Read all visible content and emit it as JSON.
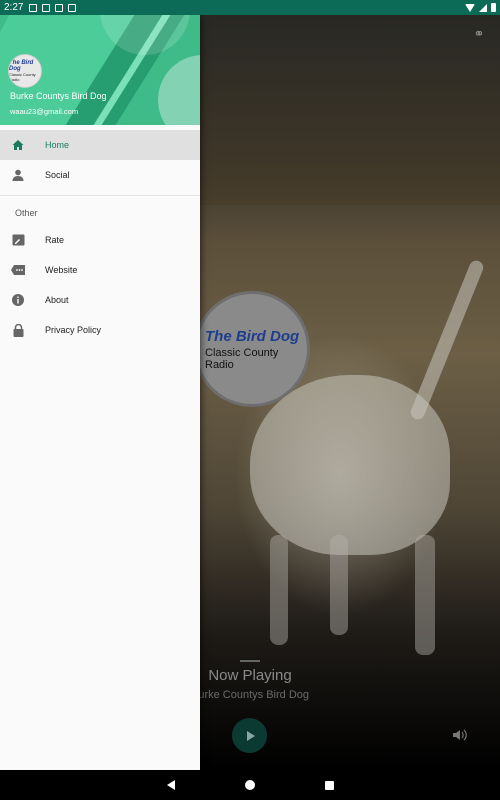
{
  "status_bar": {
    "time": "2:27",
    "icons": [
      "cast-icon",
      "sd-card-icon",
      "sim-icon",
      "sim-icon-2"
    ],
    "right_icons": [
      "wifi-icon",
      "cell-signal-icon",
      "battery-icon"
    ]
  },
  "drawer": {
    "header": {
      "title": "Burke Countys Bird Dog",
      "email": "waau23@gmail.com",
      "avatar_line1": "The Bird Dog",
      "avatar_line2": "Classic County Radio"
    },
    "items": [
      {
        "label": "Home",
        "icon": "home-icon",
        "active": true
      },
      {
        "label": "Social",
        "icon": "person-icon",
        "active": false
      }
    ],
    "section_label": "Other",
    "other_items": [
      {
        "label": "Rate",
        "icon": "rate-icon"
      },
      {
        "label": "Website",
        "icon": "website-icon"
      },
      {
        "label": "About",
        "icon": "info-icon"
      },
      {
        "label": "Privacy Policy",
        "icon": "lock-icon"
      }
    ]
  },
  "player": {
    "logo_line1": "The Bird Dog",
    "logo_line2": "Classic County Radio",
    "now_playing": "Now Playing",
    "station": "Burke Countys Bird Dog",
    "accent_color": "#0b3a33"
  },
  "colors": {
    "status_bar": "#0c6b57",
    "header_green": "#3fbb8a",
    "active_text": "#1a7a60"
  }
}
